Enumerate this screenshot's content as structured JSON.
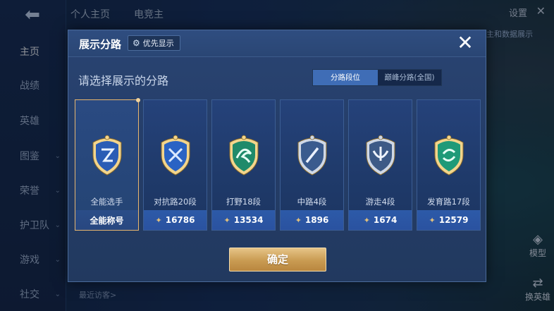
{
  "background": {
    "back_icon": "back-arrow-icon",
    "sidebar": [
      {
        "label": "主页",
        "active": true,
        "chevron": false
      },
      {
        "label": "战绩",
        "active": false,
        "chevron": false
      },
      {
        "label": "英雄",
        "active": false,
        "chevron": false
      },
      {
        "label": "图鉴",
        "active": false,
        "chevron": true
      },
      {
        "label": "荣誉",
        "active": false,
        "chevron": true
      },
      {
        "label": "护卫队",
        "active": false,
        "chevron": true
      },
      {
        "label": "游戏",
        "active": false,
        "chevron": true
      },
      {
        "label": "社交",
        "active": false,
        "chevron": true
      }
    ],
    "top_tabs": [
      "个人主页",
      "电竞主"
    ],
    "settings_label": "设置",
    "hint_text": "主和数据展示",
    "recent_visitors_label": "最近访客>",
    "model_label": "模型",
    "swap_hero_label": "换英雄"
  },
  "modal": {
    "title": "展示分路",
    "priority_label": "优先显示",
    "subtitle": "请选择展示的分路",
    "segments": [
      {
        "label": "分路段位",
        "active": true
      },
      {
        "label": "巅峰分路(全国)",
        "active": false
      }
    ],
    "cards": [
      {
        "name": "全能选手",
        "bottom": "全能称号",
        "selected": true,
        "emblem": "all-round-emblem-icon",
        "score_icon": false
      },
      {
        "name": "对抗路20段",
        "bottom": "16786",
        "selected": false,
        "emblem": "clash-lane-emblem-icon",
        "score_icon": true
      },
      {
        "name": "打野18段",
        "bottom": "13534",
        "selected": false,
        "emblem": "jungle-emblem-icon",
        "score_icon": true
      },
      {
        "name": "中路4段",
        "bottom": "1896",
        "selected": false,
        "emblem": "mid-lane-emblem-icon",
        "score_icon": true
      },
      {
        "name": "游走4段",
        "bottom": "1674",
        "selected": false,
        "emblem": "roam-emblem-icon",
        "score_icon": true
      },
      {
        "name": "发育路17段",
        "bottom": "12579",
        "selected": false,
        "emblem": "farm-lane-emblem-icon",
        "score_icon": true
      }
    ],
    "confirm_label": "确定"
  },
  "colors": {
    "accent_gold": "#e8b66f",
    "tab_active": "#3f6db6",
    "card_bottom": "#2d5aa8"
  }
}
